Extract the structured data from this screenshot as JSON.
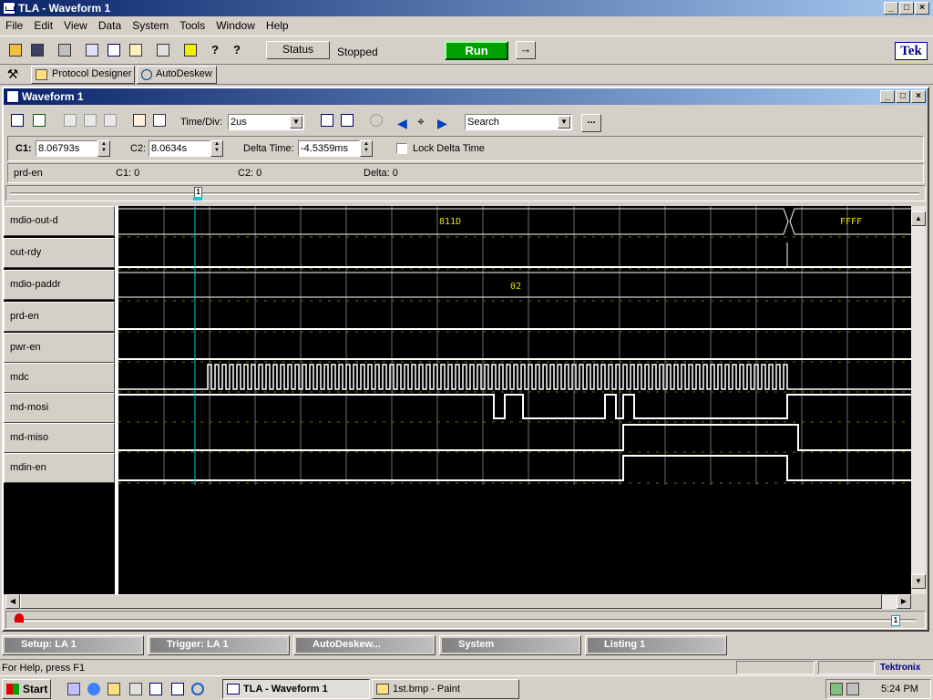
{
  "app": {
    "title": "TLA - Waveform 1",
    "brand": "Tek",
    "caption_buttons": [
      "_",
      "□",
      "×"
    ]
  },
  "menu": [
    "File",
    "Edit",
    "View",
    "Data",
    "System",
    "Tools",
    "Window",
    "Help"
  ],
  "toolbar": {
    "status_label": "Status",
    "state_text": "Stopped",
    "run_label": "Run",
    "arrow_label": "→"
  },
  "toolbar2": {
    "protocol_designer": "Protocol Designer",
    "autodeskew": "AutoDeskew"
  },
  "waveform_window": {
    "title": "Waveform 1",
    "timediv_label": "Time/Div:",
    "timediv_value": "2us",
    "search_value": "Search",
    "ellipsis": "...",
    "c1_label": "C1:",
    "c1_value": "8.06793s",
    "c2_label": "C2:",
    "c2_value": "8.0634s",
    "delta_label": "Delta Time:",
    "delta_value": "-4.5359ms",
    "lock_label": "Lock Delta Time",
    "lock_checked": false,
    "readout": {
      "signal": "prd-en",
      "c1": "C1: 0",
      "c2": "C2: 0",
      "delta": "Delta: 0"
    },
    "cursor_marker": "1",
    "signals": [
      "mdio-out-d",
      "out-rdy",
      "mdio-paddr",
      "prd-en",
      "pwr-en",
      "mdc",
      "md-mosi",
      "md-miso",
      "mdin-en"
    ],
    "bus_values": {
      "mdio_out_d_1": "811D",
      "mdio_out_d_2": "FFFF",
      "mdio_paddr": "02"
    }
  },
  "minimized_windows": [
    "Setup: LA 1",
    "Trigger: LA 1",
    "AutoDeskew...",
    "System",
    "Listing 1"
  ],
  "statusbar": {
    "help_text": "For Help, press F1",
    "brand": "Tektronix"
  },
  "taskbar": {
    "start_label": "Start",
    "tasks": [
      "TLA - Waveform 1",
      "1st.bmp - Paint"
    ],
    "clock": "5:24 PM"
  },
  "colors": {
    "title_active": "#0a246a",
    "run_green": "#00a000",
    "waveform": "#ffffff",
    "bus_text": "#e6e600",
    "cursor": "#00c8e6",
    "grid": "#6e6e6e"
  },
  "icons": [
    "open-icon",
    "save-icon",
    "print-icon",
    "setup-icon",
    "new-window-icon",
    "system-icon",
    "trigger-icon",
    "edit-icon",
    "help-pointer-icon",
    "help-icon",
    "protocol-designer-icon",
    "autodeskew-icon",
    "binoculars-icon",
    "magnifier-icon"
  ]
}
